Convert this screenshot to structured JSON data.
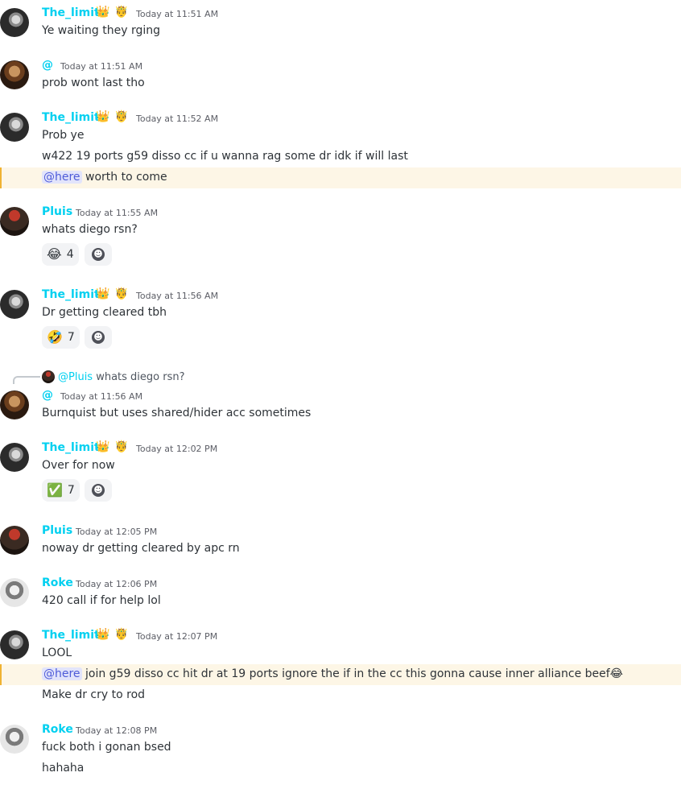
{
  "messages": [
    {
      "author": "The_limit",
      "time": "Today at 11:51 AM",
      "lines": [
        "Ye waiting they rging"
      ]
    },
    {
      "author": "@",
      "time": "Today at 11:51 AM",
      "lines": [
        "prob wont last tho"
      ]
    },
    {
      "author": "The_limit",
      "time": "Today at 11:52 AM",
      "lines": [
        "Prob ye",
        "w422 19 ports g59 disso cc if u wanna rag some dr idk if will last"
      ],
      "mention_line": {
        "mention": "@here",
        "text": " worth to come"
      }
    },
    {
      "author": "Pluis",
      "time": "Today at 11:55 AM",
      "lines": [
        "whats diego rsn?"
      ],
      "reaction": {
        "emoji": "😂",
        "count": "4"
      }
    },
    {
      "author": "The_limit",
      "time": "Today at 11:56 AM",
      "lines": [
        "Dr getting cleared tbh"
      ],
      "reaction": {
        "emoji": "🤣",
        "count": "7"
      }
    },
    {
      "author": "@",
      "time": "Today at 11:56 AM",
      "lines": [
        "Burnquist but uses shared/hider acc sometimes"
      ],
      "reply": {
        "author": "@Pluis",
        "text": "whats diego rsn?"
      }
    },
    {
      "author": "The_limit",
      "time": "Today at 12:02 PM",
      "lines": [
        "Over for now"
      ],
      "reaction": {
        "emoji": "✅",
        "count": "7"
      }
    },
    {
      "author": "Pluis",
      "time": "Today at 12:05 PM",
      "lines": [
        "noway dr getting cleared by apc rn"
      ]
    },
    {
      "author": "Roke",
      "time": "Today at 12:06 PM",
      "lines": [
        "420 call if for help lol"
      ]
    },
    {
      "author": "The_limit",
      "time": "Today at 12:07 PM",
      "lines": [
        "LOOL"
      ],
      "mention_line": {
        "mention": "@here",
        "text": " join g59 disso cc hit dr at 19 ports ignore the if in the cc this gonna cause inner alliance beef😂"
      },
      "after_lines": [
        "Make dr cry to rod"
      ]
    },
    {
      "author": "Roke",
      "time": "Today at 12:08 PM",
      "lines": [
        "fuck both i gonan bsed",
        "hahaha"
      ]
    }
  ],
  "badges": {
    "crown": "👑",
    "king": "🤴"
  },
  "icons": {
    "add_reaction": "smile-plus-icon"
  }
}
